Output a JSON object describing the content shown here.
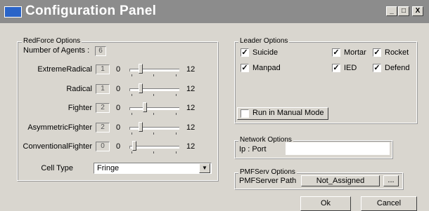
{
  "window": {
    "title": "Configuration Panel",
    "minimize": "_",
    "maximize": "□",
    "close": "X"
  },
  "redforce": {
    "legend": "RedForce Options",
    "num_agents_label": "Number of Agents :",
    "num_agents_value": "6",
    "min_label": "0",
    "max_label": "12",
    "rows": [
      {
        "label": "ExtremeRadical",
        "value": "1"
      },
      {
        "label": "Radical",
        "value": "1"
      },
      {
        "label": "Fighter",
        "value": "2"
      },
      {
        "label": "AsymmetricFighter",
        "value": "2"
      },
      {
        "label": "ConventionalFighter",
        "value": "0"
      }
    ],
    "cell_type_label": "Cell Type",
    "cell_type_value": "Fringe"
  },
  "leader": {
    "legend": "Leader Options",
    "options": [
      {
        "label": "Suicide",
        "checked": true
      },
      {
        "label": "Mortar",
        "checked": true
      },
      {
        "label": "Rocket",
        "checked": true
      },
      {
        "label": "Manpad",
        "checked": true
      },
      {
        "label": "IED",
        "checked": true
      },
      {
        "label": "Defend",
        "checked": true
      }
    ],
    "manual_mode_label": "Run in Manual Mode",
    "manual_mode_checked": false
  },
  "network": {
    "legend": "Network Options",
    "ip_label": "Ip : Port",
    "ip_value": ""
  },
  "pmf": {
    "legend": "PMFServ Options",
    "path_label": "PMFServer Path",
    "path_value": "Not_Assigned",
    "browse_label": "..."
  },
  "buttons": {
    "ok": "Ok",
    "cancel": "Cancel"
  }
}
